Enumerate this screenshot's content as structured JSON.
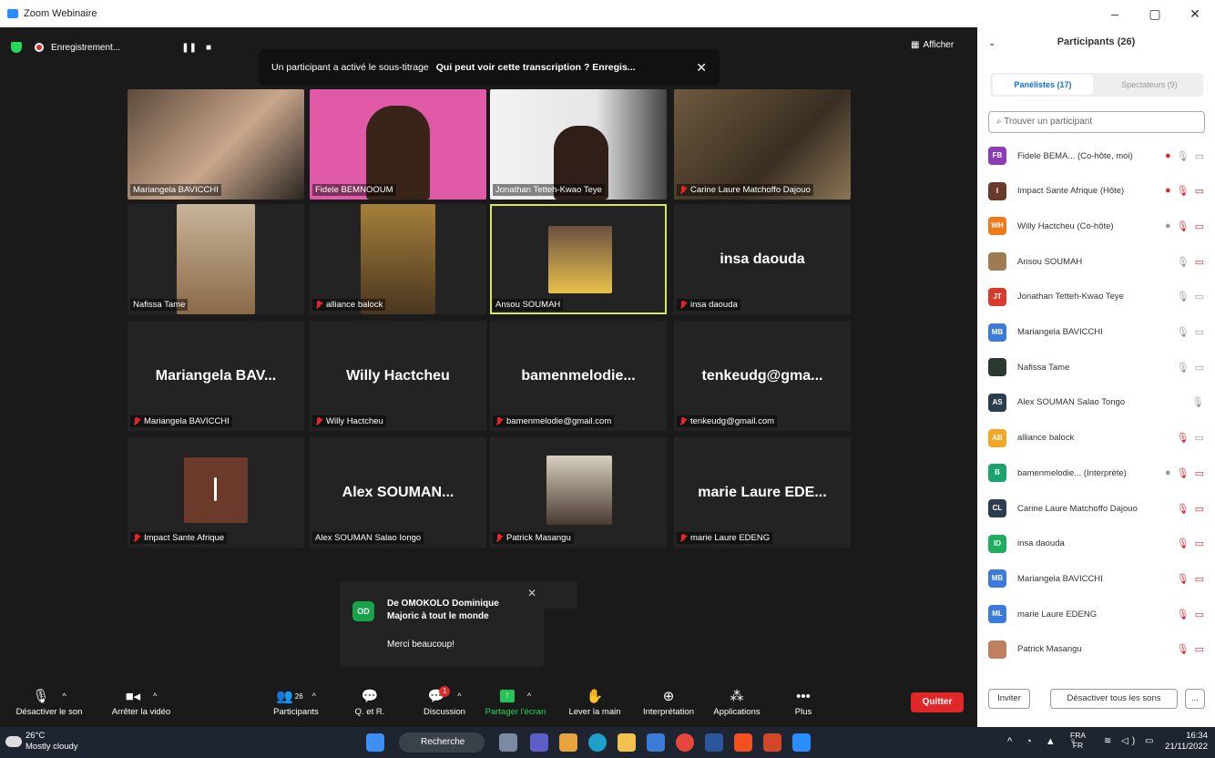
{
  "app": {
    "title": "Zoom Webinaire",
    "window_controls": [
      "–",
      "▢",
      "✕"
    ]
  },
  "recording": {
    "label": "Enregistrement...",
    "pause": "❚❚",
    "stop": "■"
  },
  "banner": {
    "text1": "Un participant a activé le sous-titrage",
    "text2": "Qui peut voir cette transcription ? Enregis...",
    "close": "✕"
  },
  "view": {
    "afficher": "Afficher"
  },
  "tiles": [
    {
      "name": "Mariangela BAVICCHI",
      "muted": false,
      "big": ""
    },
    {
      "name": "Fidele BEMNOOUM",
      "muted": false,
      "big": ""
    },
    {
      "name": "Jonathan Tetteh-Kwao Teye",
      "muted": false,
      "big": ""
    },
    {
      "name": "Carine Laure Matchoffo Dajouo",
      "muted": true,
      "big": ""
    },
    {
      "name": "Nafissa Tame",
      "muted": false,
      "big": ""
    },
    {
      "name": "alliance balock",
      "muted": true,
      "big": ""
    },
    {
      "name": "Ansou SOUMAH",
      "muted": false,
      "big": ""
    },
    {
      "name": "insa daouda",
      "muted": true,
      "big": "insa daouda"
    },
    {
      "name": "Mariangela BAVICCHI",
      "muted": true,
      "big": "Mariangela BAV..."
    },
    {
      "name": "Willy Hactcheu",
      "muted": true,
      "big": "Willy Hactcheu"
    },
    {
      "name": "bamenmelodie@gmail.com",
      "muted": true,
      "big": "bamenmelodie..."
    },
    {
      "name": "tenkeudg@gmail.com",
      "muted": true,
      "big": "tenkeudg@gma..."
    },
    {
      "name": "Impact Sante Afrique",
      "muted": true,
      "big": ""
    },
    {
      "name": "Alex SOUMAN Salao Iongo",
      "muted": false,
      "big": "Alex SOUMAN..."
    },
    {
      "name": "Patrick Masangu",
      "muted": true,
      "big": ""
    },
    {
      "name": "marie Laure EDENG",
      "muted": true,
      "big": "marie Laure EDE..."
    }
  ],
  "toast": {
    "initials": "OD",
    "from": "De OMOKOLO Dominique Majoric à tout le monde",
    "message": "Merci beaucoup!",
    "close": "✕"
  },
  "toolbar": {
    "mute": "Désactiver le son",
    "video": "Arrêter la vidéo",
    "participants": "Participants",
    "participants_count": "26",
    "qa": "Q. et R.",
    "chat": "Discussion",
    "chat_badge": "1",
    "share": "Partager l'écran",
    "hand": "Lever la main",
    "interp": "Interprétation",
    "apps": "Applications",
    "more": "Plus",
    "quit": "Quitter"
  },
  "panel": {
    "title": "Participants (26)",
    "tab_panelists": "Panélistes (17)",
    "tab_attendees": "Spectateurs (9)",
    "search_placeholder": "Trouver un participant",
    "participants": [
      {
        "initials": "FB",
        "color": "#8e3bb7",
        "name": "Fidele BEMA...  (Co-hôte, moi)"
      },
      {
        "initials": "I",
        "color": "#6b3a2a",
        "name": "Impact Sante Afrique (Hôte)"
      },
      {
        "initials": "WH",
        "color": "#f07a1a",
        "name": "Willy Hactcheu (Co-hôte)"
      },
      {
        "initials": "",
        "color": "#a07a50",
        "name": "Ansou SOUMAH"
      },
      {
        "initials": "JT",
        "color": "#d93b2b",
        "name": "Jonathan Tetteh-Kwao Teye"
      },
      {
        "initials": "MB",
        "color": "#3b7be0",
        "name": "Mariangela BAVICCHI"
      },
      {
        "initials": "",
        "color": "#2a3a30",
        "name": "Nafissa Tame"
      },
      {
        "initials": "AS",
        "color": "#2b3e50",
        "name": "Alex SOUMAN Salao Tongo"
      },
      {
        "initials": "AB",
        "color": "#f5a623",
        "name": "alliance balock"
      },
      {
        "initials": "B",
        "color": "#1aa36b",
        "name": "bamenmelodie...   (Interprète)"
      },
      {
        "initials": "CL",
        "color": "#2b3e50",
        "name": "Carine Laure Matchoffo Dajouo"
      },
      {
        "initials": "ID",
        "color": "#1fae5b",
        "name": "insa daouda"
      },
      {
        "initials": "MB",
        "color": "#3b7be0",
        "name": "Mariangela BAVICCHI"
      },
      {
        "initials": "ML",
        "color": "#3b7be0",
        "name": "marie Laure EDENG"
      },
      {
        "initials": "",
        "color": "#c08060",
        "name": "Patrick Masangu"
      }
    ],
    "invite": "Inviter",
    "mute_all": "Désactiver tous les sons",
    "more": "..."
  },
  "taskbar": {
    "temp": "26°C",
    "weather": "Mostly cloudy",
    "search": "Recherche",
    "lang1": "FRA",
    "lang2": "FR",
    "time": "16:34",
    "date": "21/11/2022"
  }
}
